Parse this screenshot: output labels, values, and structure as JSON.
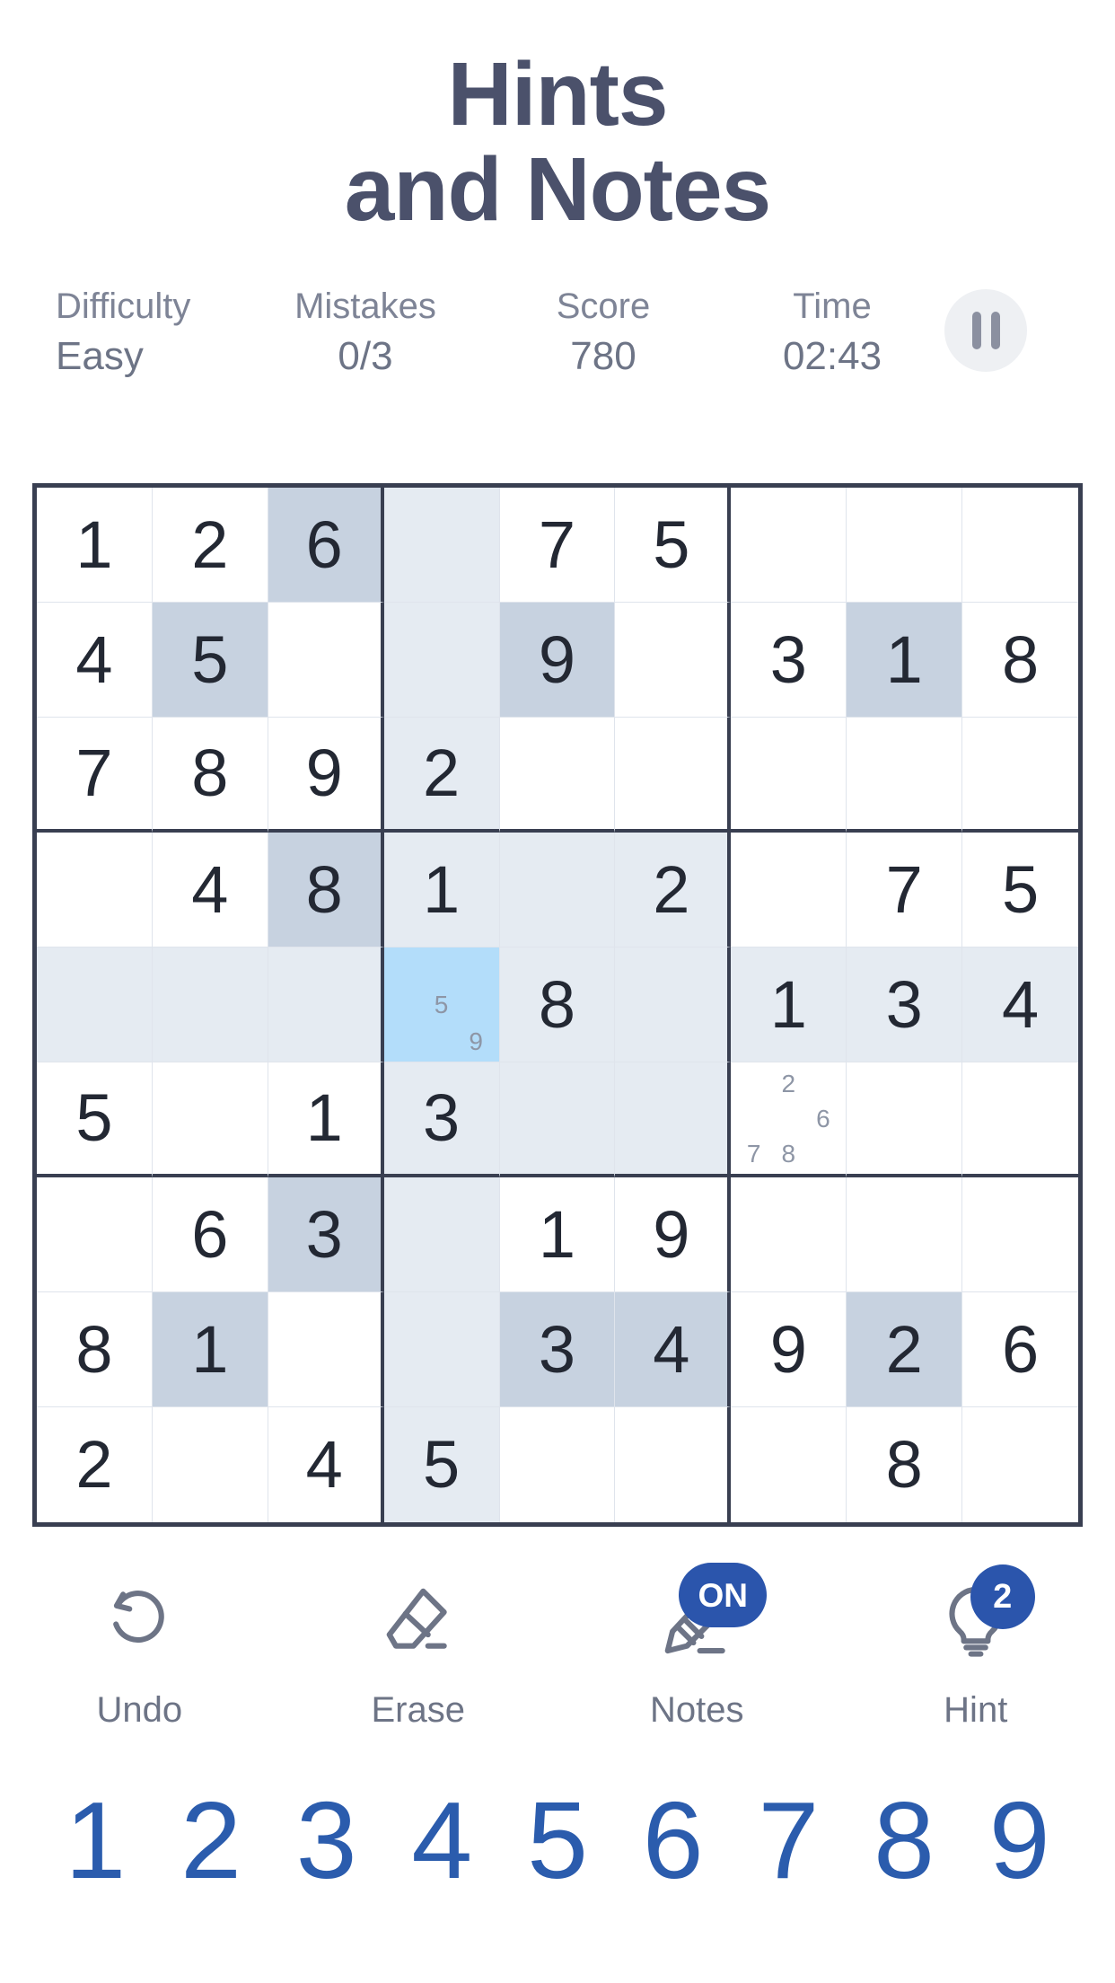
{
  "header": {
    "title_line1": "Hints",
    "title_line2": "and Notes"
  },
  "status": {
    "difficulty_label": "Difficulty",
    "difficulty_value": "Easy",
    "mistakes_label": "Mistakes",
    "mistakes_value": "0/3",
    "score_label": "Score",
    "score_value": "780",
    "time_label": "Time",
    "time_value": "02:43",
    "pause_icon": "pause-icon"
  },
  "grid": {
    "rows": [
      [
        {
          "v": "1",
          "s": "none"
        },
        {
          "v": "2",
          "s": "none"
        },
        {
          "v": "6",
          "s": "peer"
        },
        {
          "v": "",
          "s": "soft"
        },
        {
          "v": "7",
          "s": "none"
        },
        {
          "v": "5",
          "s": "none"
        },
        {
          "v": "",
          "s": "none"
        },
        {
          "v": "",
          "s": "none"
        },
        {
          "v": "",
          "s": "none"
        }
      ],
      [
        {
          "v": "4",
          "s": "none"
        },
        {
          "v": "5",
          "s": "peer"
        },
        {
          "v": "",
          "s": "none"
        },
        {
          "v": "",
          "s": "soft"
        },
        {
          "v": "9",
          "s": "peer"
        },
        {
          "v": "",
          "s": "none"
        },
        {
          "v": "3",
          "s": "none"
        },
        {
          "v": "1",
          "s": "peer"
        },
        {
          "v": "8",
          "s": "none"
        }
      ],
      [
        {
          "v": "7",
          "s": "none"
        },
        {
          "v": "8",
          "s": "none"
        },
        {
          "v": "9",
          "s": "none"
        },
        {
          "v": "2",
          "s": "soft"
        },
        {
          "v": "",
          "s": "none"
        },
        {
          "v": "",
          "s": "none"
        },
        {
          "v": "",
          "s": "none"
        },
        {
          "v": "",
          "s": "none"
        },
        {
          "v": "",
          "s": "none"
        }
      ],
      [
        {
          "v": "",
          "s": "none"
        },
        {
          "v": "4",
          "s": "none"
        },
        {
          "v": "8",
          "s": "peer"
        },
        {
          "v": "1",
          "s": "soft"
        },
        {
          "v": "",
          "s": "soft"
        },
        {
          "v": "2",
          "s": "soft"
        },
        {
          "v": "",
          "s": "none"
        },
        {
          "v": "7",
          "s": "none"
        },
        {
          "v": "5",
          "s": "none"
        }
      ],
      [
        {
          "v": "",
          "s": "soft"
        },
        {
          "v": "",
          "s": "soft"
        },
        {
          "v": "",
          "s": "soft"
        },
        {
          "v": "",
          "s": "sel",
          "notes": [
            "5",
            "9"
          ]
        },
        {
          "v": "8",
          "s": "soft"
        },
        {
          "v": "",
          "s": "soft"
        },
        {
          "v": "1",
          "s": "soft"
        },
        {
          "v": "3",
          "s": "soft"
        },
        {
          "v": "4",
          "s": "soft"
        }
      ],
      [
        {
          "v": "5",
          "s": "none"
        },
        {
          "v": "",
          "s": "none"
        },
        {
          "v": "1",
          "s": "none"
        },
        {
          "v": "3",
          "s": "soft"
        },
        {
          "v": "",
          "s": "soft"
        },
        {
          "v": "",
          "s": "soft"
        },
        {
          "v": "",
          "s": "none",
          "notes": [
            "2",
            "6",
            "7",
            "8"
          ]
        },
        {
          "v": "",
          "s": "none"
        },
        {
          "v": "",
          "s": "none"
        }
      ],
      [
        {
          "v": "",
          "s": "none"
        },
        {
          "v": "6",
          "s": "none"
        },
        {
          "v": "3",
          "s": "peer"
        },
        {
          "v": "",
          "s": "soft"
        },
        {
          "v": "1",
          "s": "none"
        },
        {
          "v": "9",
          "s": "none"
        },
        {
          "v": "",
          "s": "none"
        },
        {
          "v": "",
          "s": "none"
        },
        {
          "v": "",
          "s": "none"
        }
      ],
      [
        {
          "v": "8",
          "s": "none"
        },
        {
          "v": "1",
          "s": "peer"
        },
        {
          "v": "",
          "s": "none"
        },
        {
          "v": "",
          "s": "soft"
        },
        {
          "v": "3",
          "s": "peer"
        },
        {
          "v": "4",
          "s": "peer"
        },
        {
          "v": "9",
          "s": "none"
        },
        {
          "v": "2",
          "s": "peer"
        },
        {
          "v": "6",
          "s": "none"
        }
      ],
      [
        {
          "v": "2",
          "s": "none"
        },
        {
          "v": "",
          "s": "none"
        },
        {
          "v": "4",
          "s": "none"
        },
        {
          "v": "5",
          "s": "soft"
        },
        {
          "v": "",
          "s": "none"
        },
        {
          "v": "",
          "s": "none"
        },
        {
          "v": "",
          "s": "none"
        },
        {
          "v": "8",
          "s": "none"
        },
        {
          "v": "",
          "s": "none"
        }
      ]
    ]
  },
  "toolbar": [
    {
      "label": "Undo",
      "icon": "undo-icon",
      "badge": null
    },
    {
      "label": "Erase",
      "icon": "eraser-icon",
      "badge": null
    },
    {
      "label": "Notes",
      "icon": "pencil-icon",
      "badge": "ON"
    },
    {
      "label": "Hint",
      "icon": "bulb-icon",
      "badge": "2"
    }
  ],
  "numpad": [
    "1",
    "2",
    "3",
    "4",
    "5",
    "6",
    "7",
    "8",
    "9"
  ],
  "colors": {
    "title": "#4b516b",
    "accent_blue": "#2b55ac",
    "number_blue": "#2b5cad",
    "selected_cell": "#b3ddfa",
    "peer_cell": "#c7d2e0",
    "soft_cell": "#e5ebf2",
    "grid_line": "#393f51"
  }
}
